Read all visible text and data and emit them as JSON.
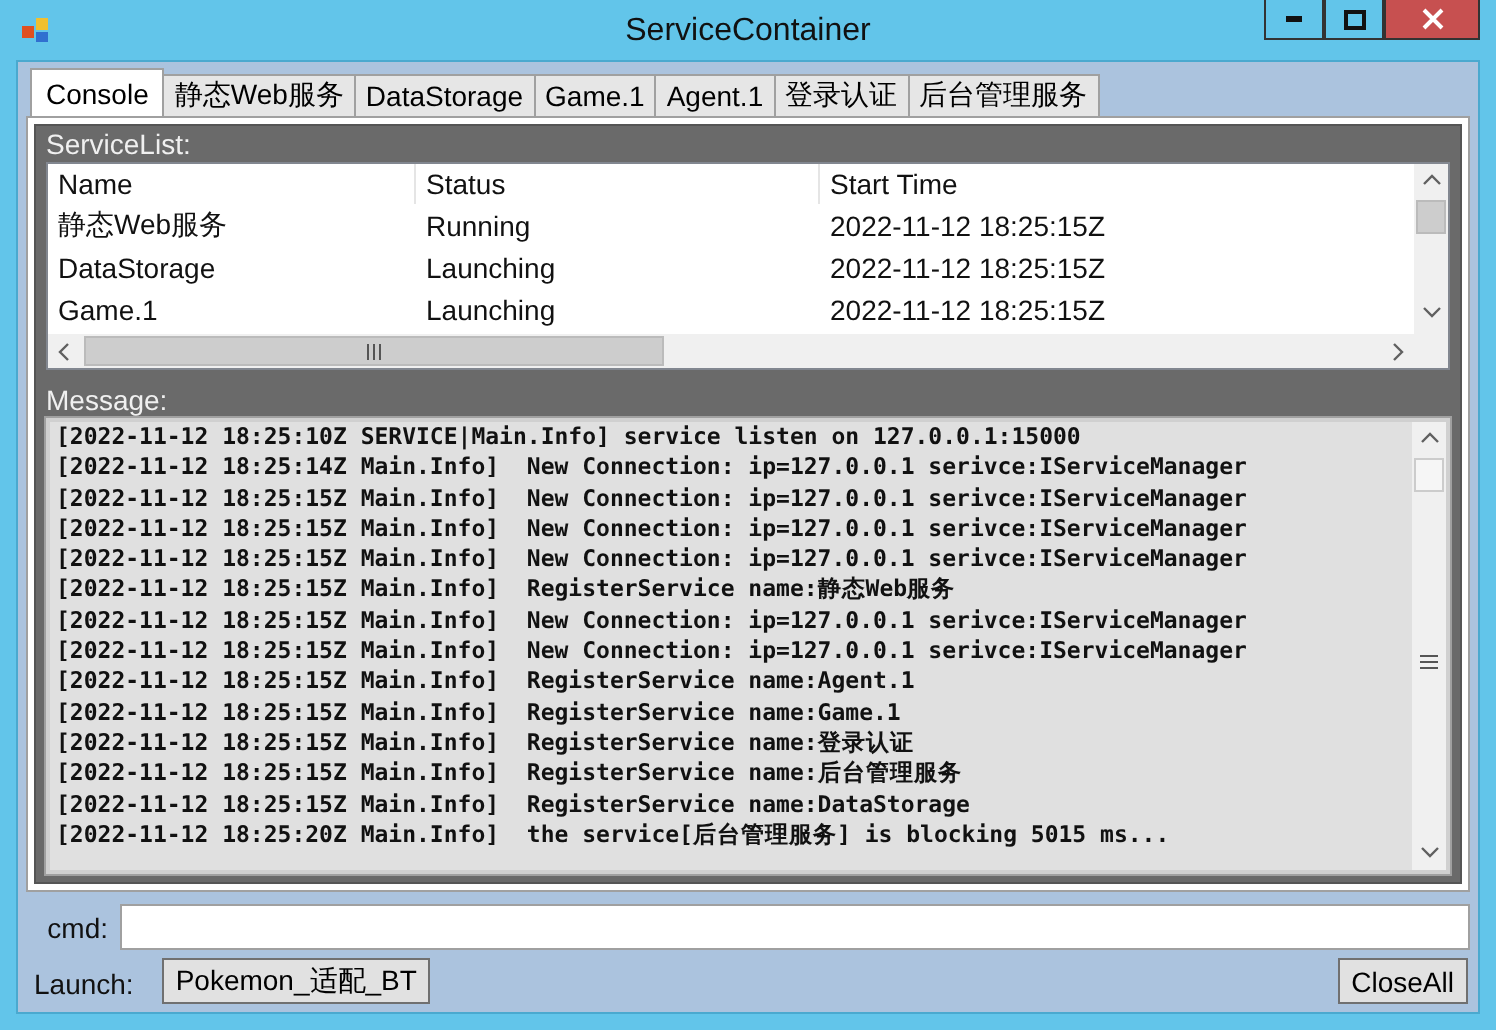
{
  "window": {
    "title": "ServiceContainer"
  },
  "tabs": [
    {
      "label": "Console",
      "selected": true
    },
    {
      "label": "静态Web服务",
      "selected": false
    },
    {
      "label": "DataStorage",
      "selected": false
    },
    {
      "label": "Game.1",
      "selected": false
    },
    {
      "label": "Agent.1",
      "selected": false
    },
    {
      "label": "登录认证",
      "selected": false
    },
    {
      "label": "后台管理服务",
      "selected": false
    }
  ],
  "service_list": {
    "label": "ServiceList:",
    "columns": [
      "Name",
      "Status",
      "Start Time"
    ],
    "rows": [
      [
        "静态Web服务",
        "Running",
        "2022-11-12 18:25:15Z"
      ],
      [
        "DataStorage",
        "Launching",
        "2022-11-12 18:25:15Z"
      ],
      [
        "Game.1",
        "Launching",
        "2022-11-12 18:25:15Z"
      ]
    ]
  },
  "message": {
    "label": "Message:",
    "lines": [
      "[2022-11-12 18:25:10Z SERVICE|Main.Info] service listen on 127.0.0.1:15000",
      "[2022-11-12 18:25:14Z Main.Info]  New Connection: ip=127.0.0.1 serivce:IServiceManager",
      "[2022-11-12 18:25:15Z Main.Info]  New Connection: ip=127.0.0.1 serivce:IServiceManager",
      "[2022-11-12 18:25:15Z Main.Info]  New Connection: ip=127.0.0.1 serivce:IServiceManager",
      "[2022-11-12 18:25:15Z Main.Info]  New Connection: ip=127.0.0.1 serivce:IServiceManager",
      "[2022-11-12 18:25:15Z Main.Info]  RegisterService name:静态Web服务",
      "[2022-11-12 18:25:15Z Main.Info]  New Connection: ip=127.0.0.1 serivce:IServiceManager",
      "[2022-11-12 18:25:15Z Main.Info]  New Connection: ip=127.0.0.1 serivce:IServiceManager",
      "[2022-11-12 18:25:15Z Main.Info]  RegisterService name:Agent.1",
      "[2022-11-12 18:25:15Z Main.Info]  RegisterService name:Game.1",
      "[2022-11-12 18:25:15Z Main.Info]  RegisterService name:登录认证",
      "[2022-11-12 18:25:15Z Main.Info]  RegisterService name:后台管理服务",
      "[2022-11-12 18:25:15Z Main.Info]  RegisterService name:DataStorage",
      "[2022-11-12 18:25:20Z Main.Info]  the service[后台管理服务] is blocking 5015 ms..."
    ]
  },
  "cmd": {
    "label": "cmd:"
  },
  "launch": {
    "label": "Launch:",
    "button": "Pokemon_适配_BT"
  },
  "close_all": {
    "button": "CloseAll"
  }
}
